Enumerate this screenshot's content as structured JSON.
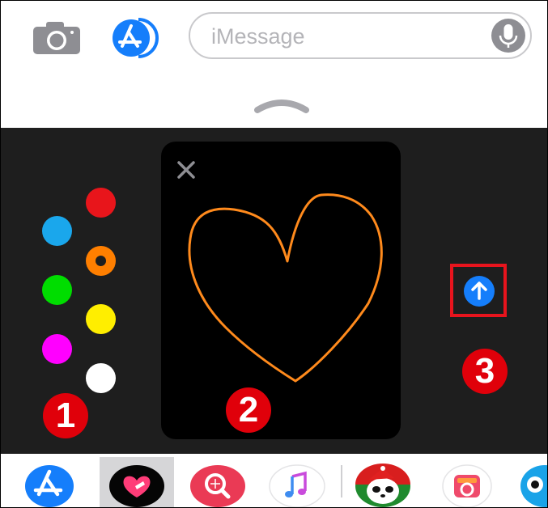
{
  "top_bar": {
    "camera_icon": "camera-icon",
    "app_store_icon": "app-store-icon",
    "message_placeholder": "iMessage",
    "mic_icon": "microphone-icon"
  },
  "grabber_icon": "chevron-up-icon",
  "digital_touch": {
    "colors": [
      "#1aa7ec",
      "#00dd00",
      "#ff00ff",
      "#e8151b",
      "#ff7f00",
      "#ffee00",
      "#ffffff"
    ],
    "selected_color": "#ff7f00",
    "stroke_color": "#ff8a1c",
    "close_icon": "close-icon",
    "send_icon": "send-arrow-icon"
  },
  "annotations": {
    "step1": "1",
    "step2": "2",
    "step3": "3"
  },
  "app_tray": {
    "apps": [
      "app-store-icon",
      "digital-touch-icon",
      "search-images-icon",
      "music-icon",
      "panda-sticker-icon",
      "camera-app-icon",
      "eye-app-icon"
    ],
    "selected_app": "digital-touch-icon"
  }
}
